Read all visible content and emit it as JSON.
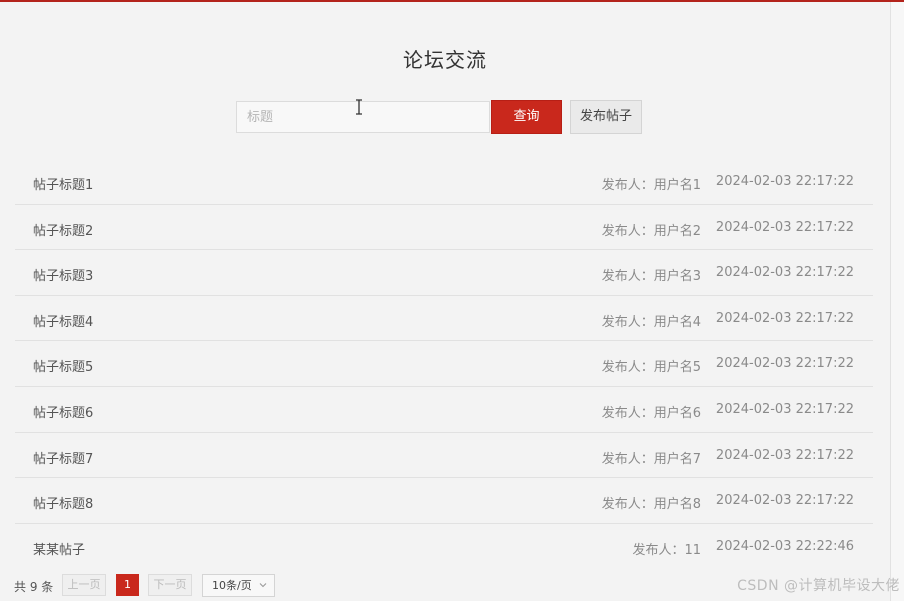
{
  "page": {
    "title": "论坛交流"
  },
  "search": {
    "placeholder": "标题",
    "query_label": "查询",
    "post_label": "发布帖子"
  },
  "posts": [
    {
      "title": "帖子标题1",
      "author": "发布人：用户名1",
      "time": "2024-02-03 22:17:22"
    },
    {
      "title": "帖子标题2",
      "author": "发布人：用户名2",
      "time": "2024-02-03 22:17:22"
    },
    {
      "title": "帖子标题3",
      "author": "发布人：用户名3",
      "time": "2024-02-03 22:17:22"
    },
    {
      "title": "帖子标题4",
      "author": "发布人：用户名4",
      "time": "2024-02-03 22:17:22"
    },
    {
      "title": "帖子标题5",
      "author": "发布人：用户名5",
      "time": "2024-02-03 22:17:22"
    },
    {
      "title": "帖子标题6",
      "author": "发布人：用户名6",
      "time": "2024-02-03 22:17:22"
    },
    {
      "title": "帖子标题7",
      "author": "发布人：用户名7",
      "time": "2024-02-03 22:17:22"
    },
    {
      "title": "帖子标题8",
      "author": "发布人：用户名8",
      "time": "2024-02-03 22:17:22"
    },
    {
      "title": "某某帖子",
      "author": "发布人：11",
      "time": "2024-02-03 22:22:46"
    }
  ],
  "pagination": {
    "total": "共 9 条",
    "prev": "上一页",
    "current_page": "1",
    "next": "下一页",
    "page_size": "10条/页"
  },
  "watermark": "CSDN @计算机毕设大佬",
  "colors": {
    "accent": "#c9281c",
    "top_rule": "#b3231b",
    "background": "#f3f3f3"
  },
  "icons": {
    "cursor": "text-cursor-icon",
    "select": "chevron-down-icon"
  }
}
